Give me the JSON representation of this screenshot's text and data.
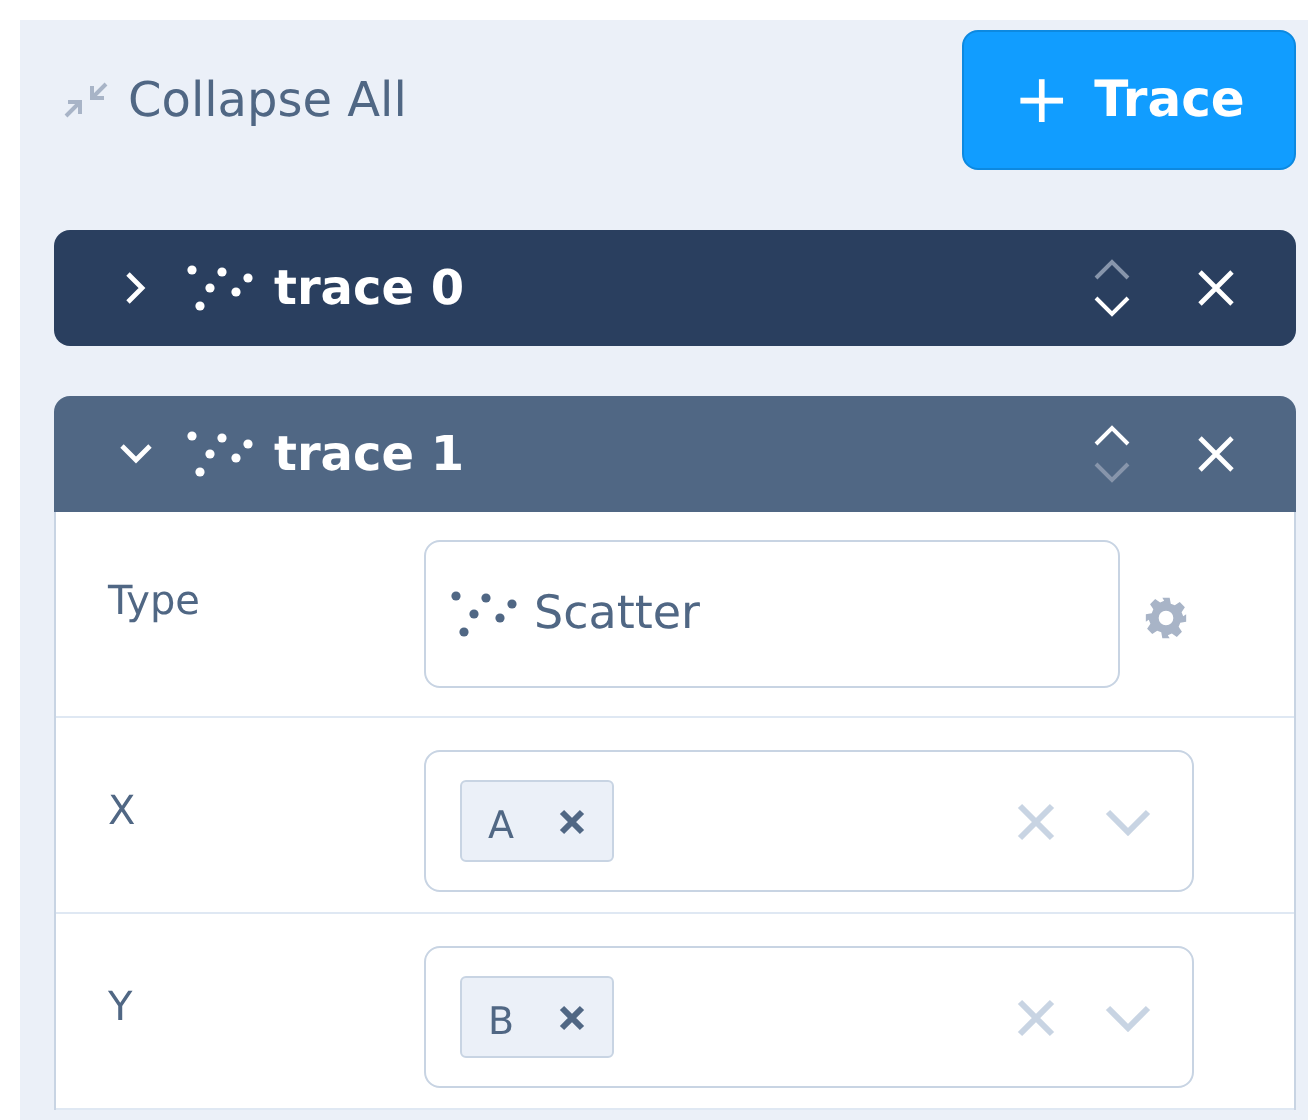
{
  "toolbar": {
    "collapse_label": "Collapse All",
    "add_button": {
      "icon": "+",
      "label": "Trace"
    }
  },
  "traces": [
    {
      "name": "trace 0",
      "expanded": false,
      "move_up_enabled": false,
      "move_down_enabled": true
    },
    {
      "name": "trace 1",
      "expanded": true,
      "move_up_enabled": true,
      "move_down_enabled": false,
      "fields": [
        {
          "kind": "select",
          "label": "Type",
          "value": "Scatter"
        },
        {
          "kind": "multi",
          "label": "X",
          "tags": [
            "A"
          ]
        },
        {
          "kind": "multi",
          "label": "Y",
          "tags": [
            "B"
          ]
        }
      ]
    }
  ]
}
